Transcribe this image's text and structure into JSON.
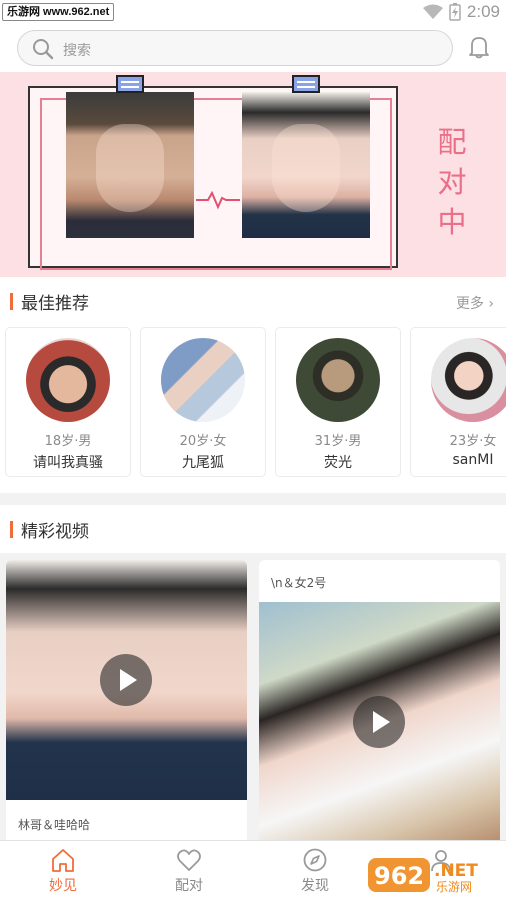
{
  "status_bar": {
    "watermark": "乐游网 www.962.net",
    "time": "2:09"
  },
  "search": {
    "placeholder": "搜索"
  },
  "banner": {
    "match_text": [
      "配",
      "对",
      "中"
    ]
  },
  "recommend": {
    "title": "最佳推荐",
    "more": "更多 ›",
    "cards": [
      {
        "age": "18岁·男",
        "name": "请叫我真骚"
      },
      {
        "age": "20岁·女",
        "name": "九尾狐"
      },
      {
        "age": "31岁·男",
        "name": "荧光"
      },
      {
        "age": "23岁·女",
        "name": "sanMI"
      }
    ]
  },
  "videos": {
    "title": "精彩视频",
    "items": [
      {
        "caption": "林哥＆哇哈哈"
      },
      {
        "caption": "\\n＆女2号"
      }
    ]
  },
  "tabbar": {
    "items": [
      {
        "label": "妙见",
        "icon": "home-icon",
        "active": true
      },
      {
        "label": "配对",
        "icon": "heart-icon",
        "active": false
      },
      {
        "label": "发现",
        "icon": "compass-icon",
        "active": false
      },
      {
        "label": "",
        "icon": "profile-icon",
        "active": false
      }
    ]
  },
  "colors": {
    "accent": "#f16c3b",
    "banner_bg": "#fde0e3",
    "match_pink": "#ea6f88"
  }
}
